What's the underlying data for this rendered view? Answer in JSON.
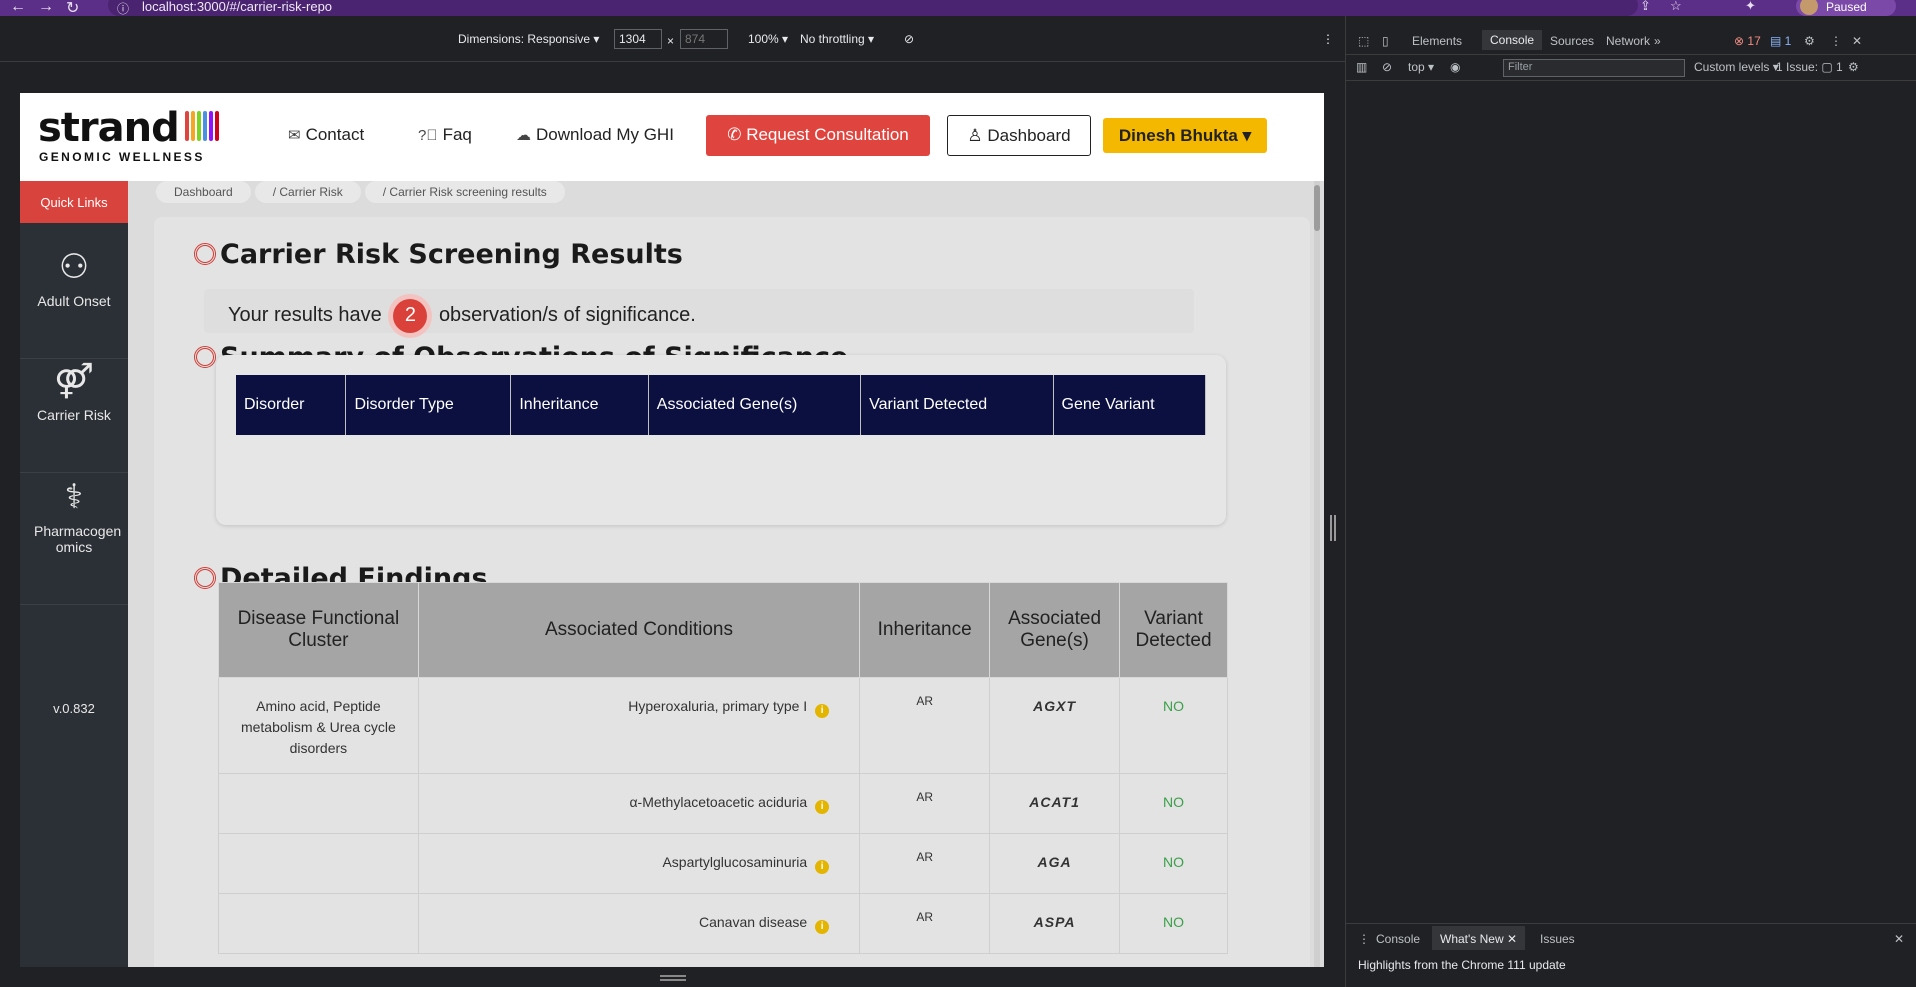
{
  "browser": {
    "url": "localhost:3000/#/carrier-risk-repo",
    "paused_label": "Paused"
  },
  "device_toolbar": {
    "dimensions_label": "Dimensions: Responsive ▾",
    "width": "1304",
    "height": "874",
    "times": "×",
    "zoom": "100% ▾",
    "throttling": "No throttling ▾"
  },
  "header": {
    "logo_word": "strand",
    "logo_subtitle": "GENOMIC WELLNESS",
    "logo_bar_colors": [
      "#e0443e",
      "#f5a623",
      "#7ed321",
      "#4a90e2",
      "#9013fe",
      "#d0021b"
    ],
    "nav": {
      "contact": "Contact",
      "faq": "Faq",
      "download": "Download My GHI"
    },
    "request_consultation": "Request Consultation",
    "dashboard": "Dashboard",
    "user": "Dinesh Bhukta ▾"
  },
  "sidebar": {
    "quick_links": "Quick Links",
    "items": [
      {
        "label": "Adult Onset",
        "icon": "people-icon"
      },
      {
        "label": "Carrier Risk",
        "icon": "couple-icon"
      },
      {
        "label": "Pharmacogen omics",
        "icon": "pill-icon"
      }
    ],
    "version": "v.0.832"
  },
  "breadcrumb": [
    "Dashboard",
    "/  Carrier Risk",
    "/  Carrier Risk screening results"
  ],
  "results": {
    "title": "Carrier Risk Screening Results",
    "obs_prefix": "Your results have",
    "obs_count": "2",
    "obs_suffix": "observation/s of significance.",
    "summary_title": "Summary of Observations of Significance",
    "summary_columns": [
      "Disorder",
      "Disorder Type",
      "Inheritance",
      "Associated Gene(s)",
      "Variant Detected",
      "Gene Variant"
    ],
    "details_title": "Detailed Findings",
    "details_columns": [
      "Disease Functional Cluster",
      "Associated Conditions",
      "Inheritance",
      "Associated Gene(s)",
      "Variant Detected"
    ],
    "rows": [
      {
        "cluster": "Amino acid, Peptide metabolism & Urea cycle disorders",
        "condition": "Hyperoxaluria, primary type I",
        "inheritance": "AR",
        "gene": "AGXT",
        "variant": "NO"
      },
      {
        "cluster": "",
        "condition": "α-Methylacetoacetic aciduria",
        "inheritance": "AR",
        "gene": "ACAT1",
        "variant": "NO"
      },
      {
        "cluster": "",
        "condition": "Aspartylglucosaminuria",
        "inheritance": "AR",
        "gene": "AGA",
        "variant": "NO"
      },
      {
        "cluster": "",
        "condition": "Canavan disease",
        "inheritance": "AR",
        "gene": "ASPA",
        "variant": "NO"
      }
    ]
  },
  "devtools": {
    "tabs": [
      "Elements",
      "Console",
      "Sources",
      "Network"
    ],
    "error_count": "17",
    "msg_count": "1",
    "context": "top ▾",
    "filter_placeholder": "Filter",
    "levels": "Custom levels ▾",
    "issues": "1 Issue: ▢ 1",
    "bottom_tabs": {
      "console": "Console",
      "whats_new": "What's New ✕",
      "issues": "Issues"
    },
    "highlights": "Highlights from the Chrome 111 update"
  }
}
